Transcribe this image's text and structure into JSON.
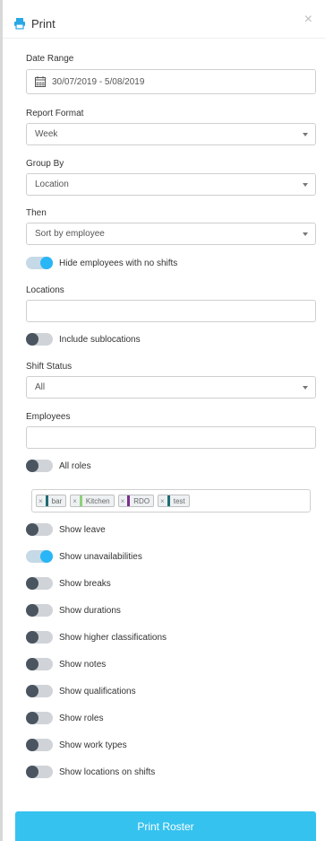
{
  "header": {
    "title": "Print",
    "close_glyph": "×",
    "icon": "printer-icon",
    "icon_color": "#29a8e6"
  },
  "date_range": {
    "label": "Date Range",
    "value": "30/07/2019 - 5/08/2019",
    "icon": "calendar-icon"
  },
  "report_format": {
    "label": "Report Format",
    "value": "Week"
  },
  "group_by": {
    "label": "Group By",
    "value": "Location"
  },
  "then": {
    "label": "Then",
    "value": "Sort by employee"
  },
  "hide_employees": {
    "label": "Hide employees with no shifts",
    "on": true
  },
  "locations": {
    "label": "Locations",
    "value": ""
  },
  "include_sublocations": {
    "label": "Include sublocations",
    "on": false
  },
  "shift_status": {
    "label": "Shift Status",
    "value": "All"
  },
  "employees": {
    "label": "Employees",
    "value": ""
  },
  "all_roles": {
    "label": "All roles",
    "on": false
  },
  "roles": [
    {
      "name": "bar",
      "color": "#1f6b73"
    },
    {
      "name": "Kitchen",
      "color": "#8fd17a"
    },
    {
      "name": "RDO",
      "color": "#7b2d8e"
    },
    {
      "name": "test",
      "color": "#1f6b73"
    }
  ],
  "options": [
    {
      "label": "Show leave",
      "on": false
    },
    {
      "label": "Show unavailabilities",
      "on": true
    },
    {
      "label": "Show breaks",
      "on": false
    },
    {
      "label": "Show durations",
      "on": false
    },
    {
      "label": "Show higher classifications",
      "on": false
    },
    {
      "label": "Show notes",
      "on": false
    },
    {
      "label": "Show qualifications",
      "on": false
    },
    {
      "label": "Show roles",
      "on": false
    },
    {
      "label": "Show work types",
      "on": false
    },
    {
      "label": "Show locations on shifts",
      "on": false
    }
  ],
  "print_button": {
    "label": "Print Roster"
  },
  "colors": {
    "accent": "#29b6f6",
    "button": "#35c2ef"
  }
}
